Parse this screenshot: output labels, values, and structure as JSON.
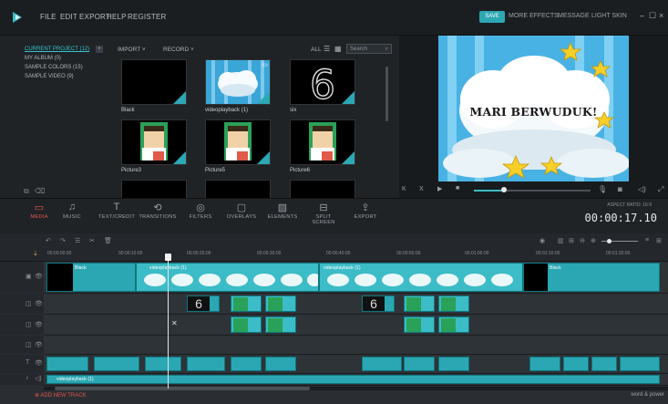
{
  "menubar": {
    "items": [
      "FILE",
      "EDIT",
      "EXPORT",
      "HELP",
      "REGISTER"
    ],
    "save_label": "SAVE",
    "right_items": [
      "MORE EFFECTS",
      "MESSAGE",
      "LIGHT SKIN"
    ]
  },
  "library": {
    "tree": [
      "CURRENT PROJECT (12)",
      "MY ALBUM (0)",
      "SAMPLE COLORS (15)",
      "SAMPLE VIDEO (9)"
    ],
    "toolbar": {
      "import": "IMPORT",
      "record": "RECORD",
      "all": "ALL",
      "search_placeholder": "Search"
    },
    "items": [
      {
        "caption": "Black"
      },
      {
        "caption": "videoplayback (1)"
      },
      {
        "caption": "six"
      },
      {
        "caption": "Picture3"
      },
      {
        "caption": "Picture5"
      },
      {
        "caption": "Picture6"
      }
    ]
  },
  "preview": {
    "title_text": "MARI BERWUDUK!",
    "controls": [
      "K",
      "X",
      "▶",
      "■"
    ]
  },
  "tools": [
    {
      "label": "MEDIA",
      "icon": "media-icon"
    },
    {
      "label": "MUSIC",
      "icon": "music-icon"
    },
    {
      "label": "TEXT/CREDIT",
      "icon": "text-icon"
    },
    {
      "label": "TRANSITIONS",
      "icon": "transitions-icon"
    },
    {
      "label": "FILTERS",
      "icon": "filters-icon"
    },
    {
      "label": "OVERLAYS",
      "icon": "overlays-icon"
    },
    {
      "label": "ELEMENTS",
      "icon": "elements-icon"
    },
    {
      "label": "SPLIT SCREEN",
      "icon": "split-screen-icon"
    },
    {
      "label": "EXPORT",
      "icon": "export-icon"
    }
  ],
  "aspect_ratio": "ASPECT RATIO: 16:9",
  "timecode": "00:00:17.10",
  "ruler": [
    "00:00:00:00",
    "00:00:10:00",
    "00:00:20:00",
    "00:00:30:00",
    "00:00:40:00",
    "00:00:50:00",
    "00:01:00:00",
    "00:01:10:00",
    "00:01:20:00"
  ],
  "timeline": {
    "video_clips": [
      "Black",
      "videoplayback (1)",
      "videoplayback (1)",
      "Black"
    ],
    "audio_clip": "videoplayback (1)",
    "add_track": "ADD NEW TRACK",
    "watermark": "word & power"
  }
}
